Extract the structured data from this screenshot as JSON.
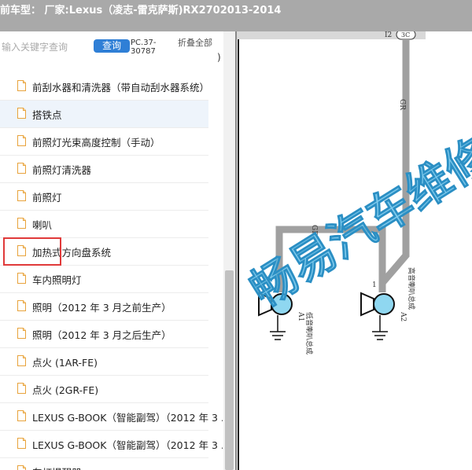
{
  "window": {
    "title": "前车型： 厂家:Lexus（凌志-雷克萨斯)RX2702013-2014"
  },
  "search": {
    "placeholder": "输入关键字查询",
    "button_label": "查询",
    "code": "PC.37-30787",
    "collapse_label": "折叠全部",
    "trailing": ")"
  },
  "list": {
    "selected_index": 1,
    "items": [
      {
        "label": "前刮水器和清洗器（带自动刮水器系统）"
      },
      {
        "label": "搭铁点"
      },
      {
        "label": "前照灯光束高度控制（手动）"
      },
      {
        "label": "前照灯清洗器"
      },
      {
        "label": "前照灯"
      },
      {
        "label": "喇叭"
      },
      {
        "label": "加热式方向盘系统"
      },
      {
        "label": "车内照明灯"
      },
      {
        "label": "照明（2012 年 3 月之前生产）"
      },
      {
        "label": "照明（2012 年 3 月之后生产）"
      },
      {
        "label": "点火 (1AR-FE)"
      },
      {
        "label": "点火 (2GR-FE)"
      },
      {
        "label": "LEXUS G-BOOK（智能副驾）（2012 年 3 ..."
      },
      {
        "label": "LEXUS G-BOOK（智能副驾）（2012 年 3 ..."
      },
      {
        "label": "车灯提醒器"
      }
    ]
  },
  "diagram": {
    "connector_label": "I2",
    "connector_pin": "3C",
    "wire_top": "GR",
    "wire_branch": "GR",
    "pin_left": "1",
    "pin_right": "1",
    "horn_left_code": "A1",
    "horn_left_name": "低音喇叭总成",
    "horn_right_code": "A2",
    "horn_right_name": "高音喇叭总成",
    "wire_color": "#a0a0a0"
  },
  "watermark": {
    "text": "畅易汽车维修",
    "color": "#4fb7e6"
  },
  "colors": {
    "accent": "#2f7fd6",
    "highlight": "#e03a3a",
    "titlebar": "#a9a9a9"
  },
  "icons": {
    "doc": "document-icon"
  }
}
